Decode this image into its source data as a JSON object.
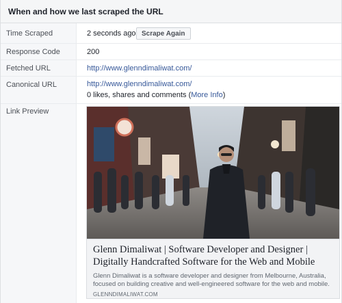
{
  "header": {
    "title": "When and how we last scraped the URL"
  },
  "rows": {
    "time_scraped": {
      "label": "Time Scraped",
      "value": "2 seconds ago",
      "button": "Scrape Again"
    },
    "response_code": {
      "label": "Response Code",
      "value": "200"
    },
    "fetched_url": {
      "label": "Fetched URL",
      "value": "http://www.glenndimaliwat.com/"
    },
    "canonical_url": {
      "label": "Canonical URL",
      "value": "http://www.glenndimaliwat.com/",
      "likes_text": "0 likes, shares and comments (",
      "more_info": "More Info",
      "likes_close": ")"
    },
    "link_preview": {
      "label": "Link Preview"
    }
  },
  "preview": {
    "title": "Glenn Dimaliwat | Software Developer and Designer | Digitally Handcrafted Software for the Web and Mobile",
    "description": "Glenn Dimaliwat is a software developer and designer from Melbourne, Australia, focused on building creative and well-engineered software for the web and mobile.",
    "domain": "GLENNDIMALIWAT.COM"
  }
}
